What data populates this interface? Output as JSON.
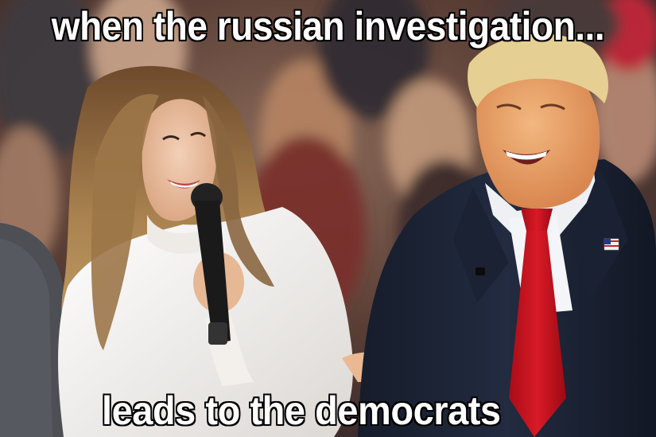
{
  "meme": {
    "top_text": "when the russian investigation...",
    "bottom_text": "leads to the democrats",
    "palette": {
      "background_crowd": "#6b4a3c",
      "white_jacket": "#f2f0ee",
      "blonde_hair": "#b08a5a",
      "microphone": "#1a1a1a",
      "navy_suit": "#1c2436",
      "red_tie": "#c8101e",
      "skin": "#e8b08a",
      "caption_text": "#ffffff",
      "caption_outline": "#000000"
    },
    "icons": [
      "us-flag-pin-icon",
      "microphone-icon"
    ]
  }
}
